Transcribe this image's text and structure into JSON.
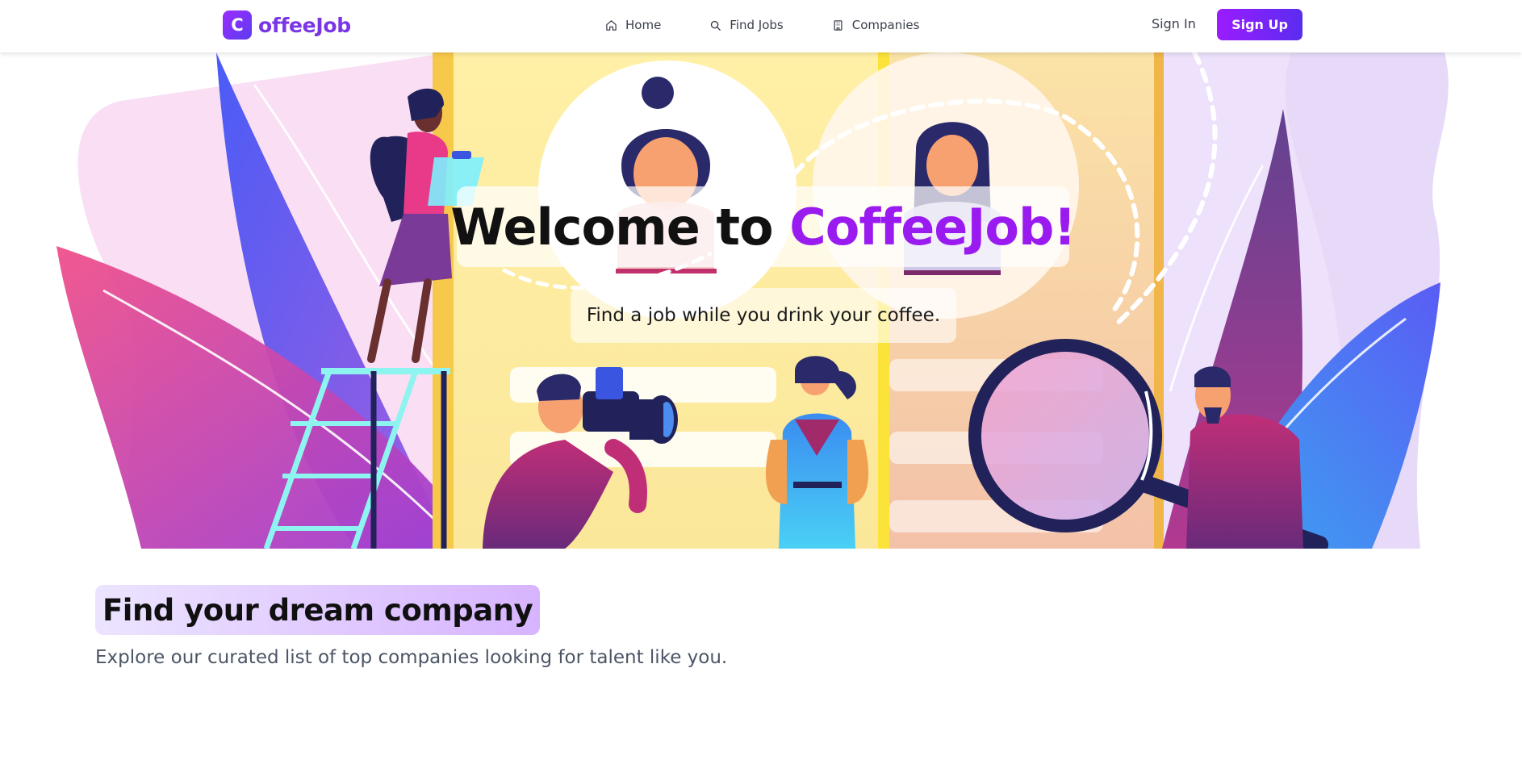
{
  "brand": {
    "logo_letter": "C",
    "name": "offeeJob",
    "accent_color": "#9a1bf0"
  },
  "nav": {
    "items": [
      {
        "label": "Home",
        "icon": "home-icon"
      },
      {
        "label": "Find Jobs",
        "icon": "search-icon"
      },
      {
        "label": "Companies",
        "icon": "building-icon"
      }
    ],
    "sign_in": "Sign In",
    "sign_up": "Sign Up"
  },
  "hero": {
    "title_prefix": "Welcome to ",
    "title_accent": "CoffeeJob!",
    "subtitle": "Find a job while you drink your coffee."
  },
  "section": {
    "title": "Find your dream company",
    "subtitle": "Explore our curated list of top companies looking for talent like you."
  }
}
